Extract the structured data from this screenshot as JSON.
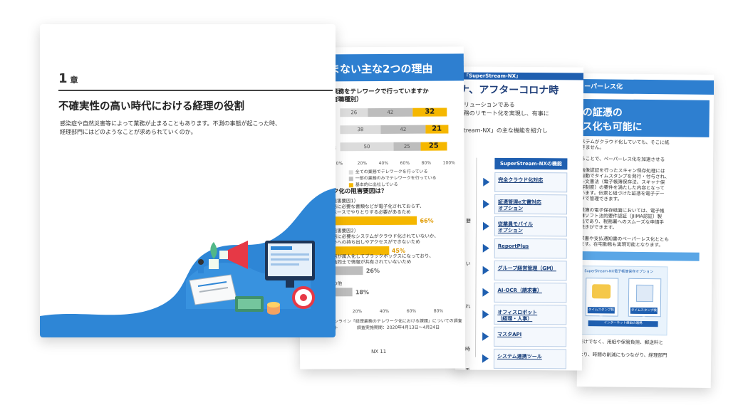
{
  "page4": {
    "header": "ーパーレス化",
    "heading_lines": [
      "の証憑の",
      "ス化も可能に"
    ],
    "text_lines": [
      "ステムがクラウド化していても、そこに紙",
      "きません。",
      "",
      "ることで、ペーパーレス化を加速させる",
      "",
      "画像認証を行ったスキャン保存処理には",
      "自動でタイムスタンプを発行・付与され、",
      "e-文書法（電子帳簿保存法、スキャナ保",
      "存制度）の要件を満たした内容となって",
      "います。伝票と紐づけた証憑を電子デー",
      "タで管理できます。",
      "",
      "帳簿の電子保存紙面においては、電子帳",
      "簿ソフト法的要件認証（JIIMA認証）製",
      "品であり、税務署へのスムーズな申請手",
      "続きができます。",
      "",
      "求書や支払通知書のペーパーレス化ととも",
      "ます。在宅勤務も実現可能となります。"
    ],
    "diagram_title": "SuperStream-NX電子帳簿保存オプション",
    "diagram_labels": [
      "タイムスタンプ発行",
      "タイムスタンプ検証",
      "インターネット経由の連携"
    ],
    "bottom_lines": [
      "だけでなく、用紙や保管負担、郵送料と",
      "",
      "なり、時間の削減にもつながり、経理部門"
    ]
  },
  "page3": {
    "topbar": "「SuperStream-NX」",
    "title": "ナ、アフターコロナ時",
    "text_lines": [
      "リューションである",
      "務のリモート化を実現し、有事に",
      "",
      "tream-NX」の主な機能を紹介し"
    ],
    "box_header": "SuperStream-NXの機能",
    "items": [
      "完全クラウド化対応",
      "証憑管理e文書対応\nオプション",
      "従業員モバイル\nオプション",
      "ReportPlus",
      "グループ経営管理（GM）",
      "AI-OCR（請求書）",
      "オフィスロボット\n（経理・人事）",
      "マスタAPI",
      "システム連携ツール"
    ],
    "left_fragments": [
      "要",
      "",
      "い",
      "",
      "れ",
      "",
      "時",
      "手"
    ]
  },
  "page2": {
    "header": "進まない主な2つの理由",
    "question_lines": [
      "在、業務をテレワークで行っていますか",
      "回答者職種別）"
    ],
    "bar_rows": [
      {
        "label": "計",
        "values": [
          26,
          42,
          32
        ]
      },
      {
        "label": "理",
        "values": [
          38,
          42,
          21
        ]
      },
      {
        "label": "の他",
        "values": [
          50,
          25,
          25
        ]
      }
    ],
    "axis_ticks": [
      "0%",
      "20%",
      "40%",
      "60%",
      "80%",
      "100%"
    ],
    "legend": [
      "全ての業務でテレワークを行っている",
      "一部の業務のみでテレワークを行っている",
      "基本的に出社している"
    ],
    "section2": "ワーク化の阻害要因は？",
    "factors": [
      {
        "lines": [
          "（阻害要因1）",
          "業務に必要な書類などが電子化されておらず、",
          "紙ベースでやりとりする必要があるため"
        ],
        "value": 66
      },
      {
        "lines": [
          "（阻害要因2）",
          "業務に必要なシステムがクラウド化されていないか、",
          "社外への持ち出しやアクセスができないため"
        ],
        "value": 45
      },
      {
        "lines": [
          "業務が属人化してブラックボックスになっており、",
          "社員同士で情報が共有されていないため"
        ],
        "value": 26
      },
      {
        "lines": [
          "その他"
        ],
        "value": 18
      }
    ],
    "axis2": [
      "0%",
      "20%",
      "40%",
      "60%",
      "80%"
    ],
    "source": "ランオンライン「経理業務のテレワーク化における課題」についての調査レポート",
    "source2": "調査実施期間：2020年4月13日～4月24日",
    "page_no": "NX 11"
  },
  "page1": {
    "chapter": "1",
    "chapter_suffix": "章",
    "title": "不確実性の高い時代における経理の役割",
    "body_lines": [
      "感染症や自然災害等によって業務が止まることもあります。不測の事態が起こった時、",
      "経理部門にはどのようなことが求められていくのか。"
    ]
  },
  "colors": {
    "blue": "#2e7fd0",
    "navy": "#1f5fb0",
    "yellow": "#f5b700",
    "gray": "#bdbdbd",
    "light": "#dcdcdc"
  }
}
